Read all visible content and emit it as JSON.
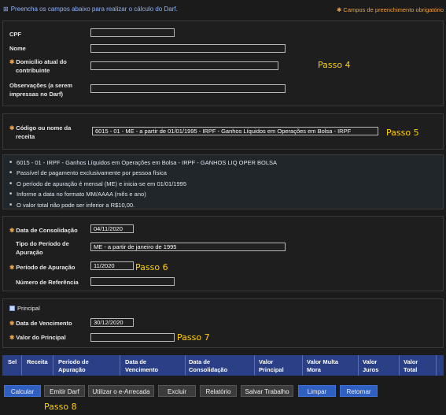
{
  "header": {
    "intro": "Preencha os campos abaixo para realizar o cálculo do Darf.",
    "required_note": "Campos de preenchimento obrigatório"
  },
  "section1": {
    "cpf_label": "CPF",
    "cpf_value": "",
    "nome_label": "Nome",
    "nome_value": "",
    "domicilio_label_line1": "Domicílio atual do",
    "domicilio_label_line2": "contribuinte",
    "domicilio_value": "",
    "obs_label_line1": "Observações (a serem",
    "obs_label_line2": "impressas no Darf)",
    "obs_value": "",
    "annotation": "Passo 4"
  },
  "section2": {
    "codigo_label_line1": "Código ou nome da",
    "codigo_label_line2": "receita",
    "codigo_value": "6015 - 01 - ME - a partir de 01/01/1995 - IRPF - Ganhos Líquidos em Operações em Bolsa - IRPF",
    "annotation": "Passo 5"
  },
  "info": {
    "items": [
      "6015 - 01 - IRPF - Ganhos Líquidos em Operações em Bolsa - IRPF - GANHOS LIQ OPER BOLSA",
      "Passível de pagamento exclusivamente por pessoa física",
      "O período de apuração é mensal (ME) e inicia-se em 01/01/1995",
      "Informe a data no formato MM/AAAA (mês e ano)",
      "O valor total não pode ser inferior a R$10,00."
    ]
  },
  "section3": {
    "consolidacao_label": "Data de Consolidação",
    "consolidacao_value": "04/11/2020",
    "tipo_label_line1": "Tipo do Período de",
    "tipo_label_line2": "Apuração",
    "tipo_value": "ME - a partir de janeiro de 1995",
    "periodo_label": "Período de Apuração",
    "periodo_value": "11/2020",
    "referencia_label": "Número de Referência",
    "referencia_value": "",
    "annotation": "Passo 6"
  },
  "section4": {
    "title": "Principal",
    "vencimento_label": "Data de Vencimento",
    "vencimento_value": "30/12/2020",
    "valor_label": "Valor do Principal",
    "valor_value": "",
    "annotation": "Passo 7"
  },
  "table": {
    "headers": [
      {
        "l1": "Sel",
        "l2": ""
      },
      {
        "l1": "Receita",
        "l2": ""
      },
      {
        "l1": "Período de",
        "l2": "Apuração"
      },
      {
        "l1": "Data de",
        "l2": "Vencimento"
      },
      {
        "l1": "Data de",
        "l2": "Consolidação"
      },
      {
        "l1": "Valor",
        "l2": "Principal"
      },
      {
        "l1": "Valor Multa",
        "l2": "Mora"
      },
      {
        "l1": "Valor",
        "l2": "Juros"
      },
      {
        "l1": "Valor",
        "l2": "Total"
      }
    ]
  },
  "buttons": {
    "calcular": "Calcular",
    "emitir": "Emitir Darf",
    "earrecada": "Utilizar o e-Arrecada",
    "excluir": "Excluir",
    "relatorio": "Relatório",
    "salvar": "Salvar Trabalho",
    "limpar": "Limpar",
    "retornar": "Retornar"
  },
  "footer_annotation": "Passo 8"
}
